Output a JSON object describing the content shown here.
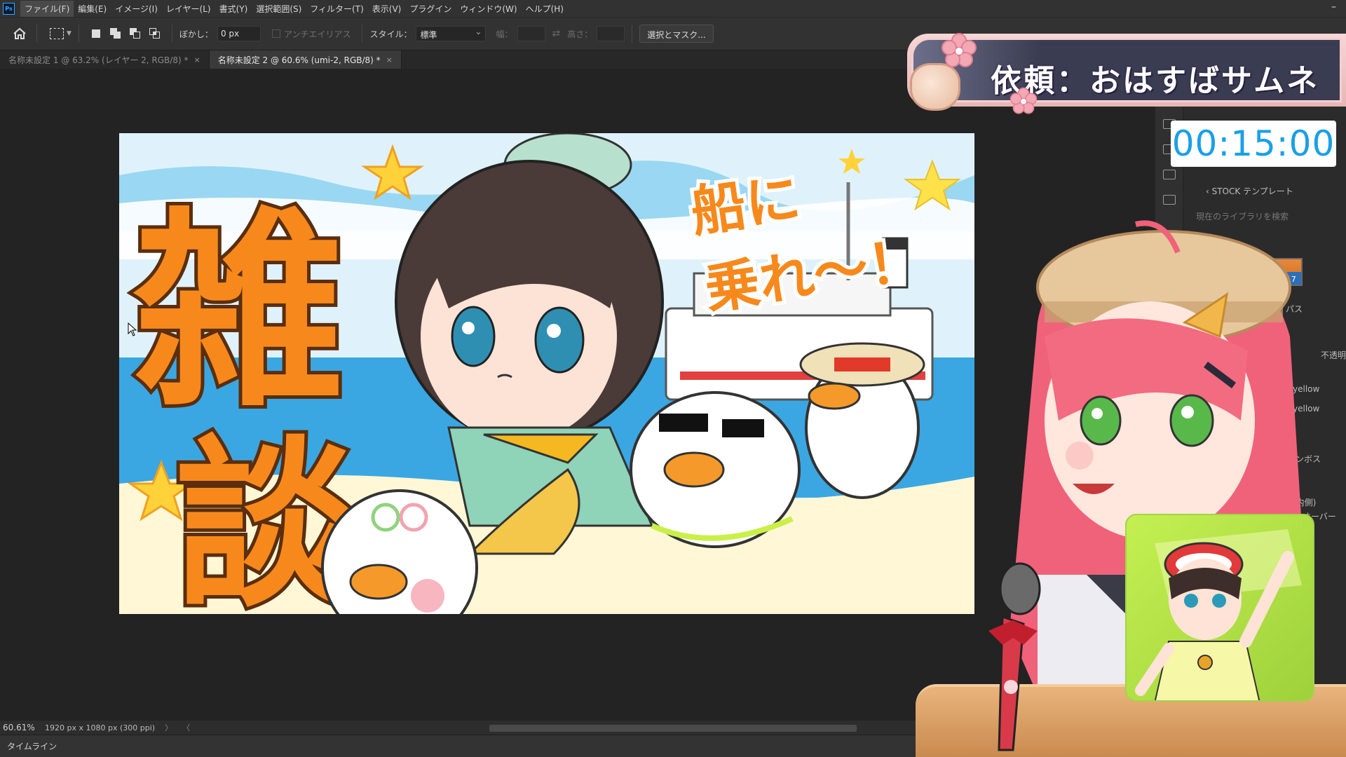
{
  "menu": {
    "items": [
      "ファイル(F)",
      "編集(E)",
      "イメージ(I)",
      "レイヤー(L)",
      "書式(Y)",
      "選択範囲(S)",
      "フィルター(T)",
      "表示(V)",
      "プラグイン",
      "ウィンドウ(W)",
      "ヘルプ(H)"
    ],
    "active_index": 0,
    "app_icon": "Ps"
  },
  "options": {
    "feather_label": "ぼかし：",
    "feather_value": "0 px",
    "antialias_label": "アンチエイリアス",
    "style_label": "スタイル：",
    "style_value": "標準",
    "width_label": "幅：",
    "height_label": "高さ：",
    "select_mask_label": "選択とマスク..."
  },
  "tabs": [
    {
      "label": "名称未設定 1 @ 63.2% (レイヤー 2, RGB/8) *",
      "active": false
    },
    {
      "label": "名称未設定 2 @ 60.6% (umi-2, RGB/8) *",
      "active": true
    }
  ],
  "tab_close_glyph": "×",
  "status": {
    "zoom": "60.61%",
    "doc_size": "1920 px x 1080 px (300 ppi)",
    "nav_glyphs": [
      "〉",
      "〈"
    ]
  },
  "timeline_label": "タイムライン",
  "right_panel": {
    "stock_label": "‹ STOCK テンプレート",
    "search_placeholder": "現在のライブラリを検索",
    "style_label": "スタイル 17",
    "paths_label": "パス",
    "opacity_label": "不透明",
    "list_items": [
      "_yellow",
      "_yellow",
      "ンボス",
      "(内側)",
      "オーバー"
    ]
  },
  "thumbnail": {
    "big_text_1": "雑",
    "big_text_2": "談",
    "small_text_1": "船に",
    "small_text_2": "乗れ〜！"
  },
  "overlay": {
    "title": "依頼：おはすばサムネ",
    "timer": "00:15:00"
  },
  "colors": {
    "ps_bg": "#232323",
    "ps_panel": "#323232",
    "accent_orange": "#f28a1c",
    "timer_blue": "#1aa0e6",
    "banner_navy": "#3a3c52",
    "sakura_pink": "#f4a7b4"
  }
}
